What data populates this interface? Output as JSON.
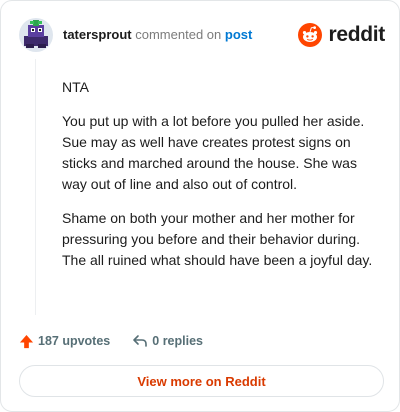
{
  "header": {
    "username": "tatersprout",
    "action_text": "commented on",
    "post_link": "post",
    "brand_name": "reddit",
    "brand_color": "#ff4500"
  },
  "comment": {
    "paragraphs": [
      "NTA",
      "You put up with a lot before you pulled her aside. Sue may as well have creates protest signs on sticks and marched around the house. She was way out of line and also out of control.",
      "Shame on both your mother and her mother for pressuring you before and their behavior during. The all ruined what should have been a joyful day."
    ]
  },
  "footer": {
    "upvotes_label": "187 upvotes",
    "replies_label": "0 replies",
    "upvote_icon": "arrow-up-icon",
    "reply_icon": "reply-arrow-icon"
  },
  "cta": {
    "label": "View more on Reddit",
    "color": "#d93a00"
  }
}
